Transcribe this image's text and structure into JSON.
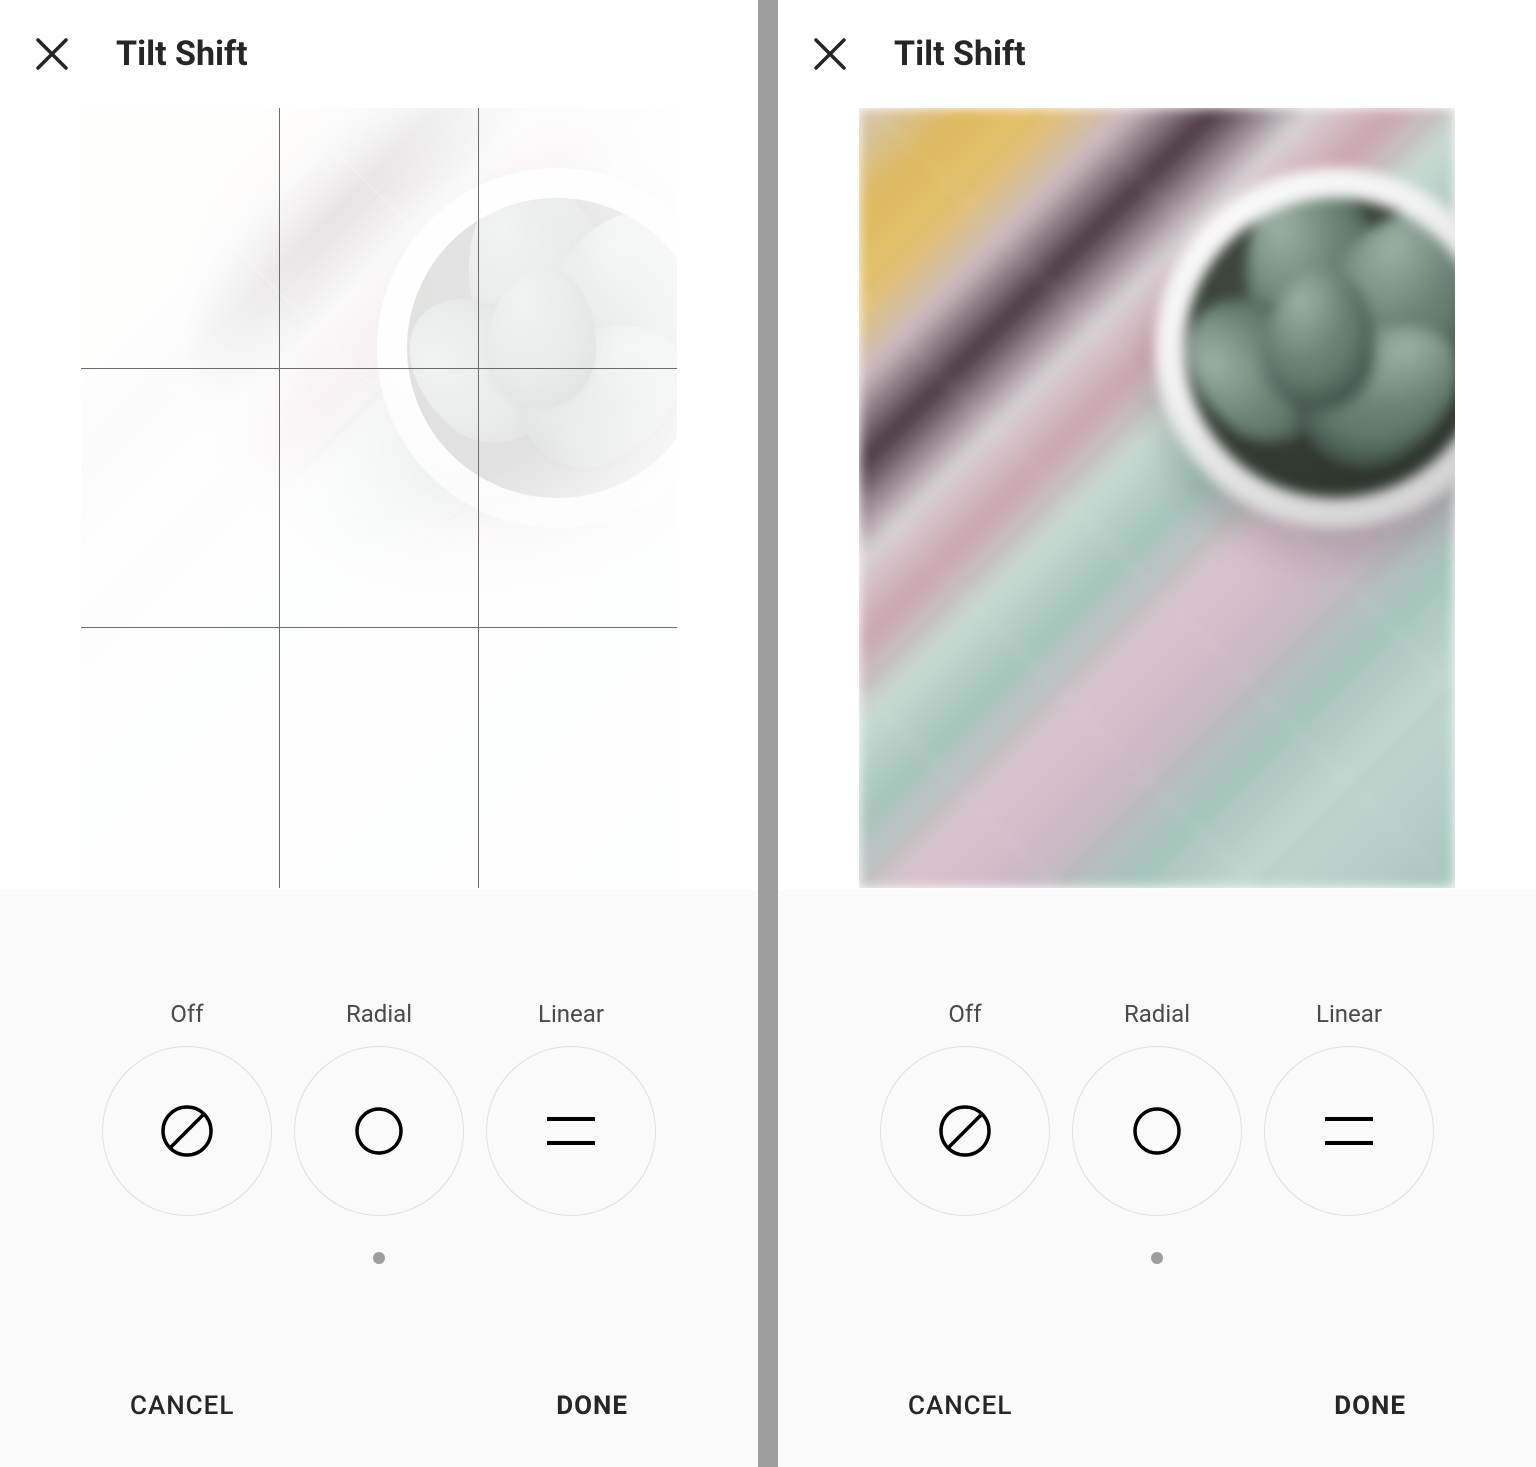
{
  "left": {
    "title": "Tilt Shift",
    "show_grid": true,
    "overlay": "washed",
    "options": {
      "off": "Off",
      "radial": "Radial",
      "linear": "Linear"
    },
    "footer": {
      "cancel": "CANCEL",
      "done": "DONE"
    }
  },
  "right": {
    "title": "Tilt Shift",
    "show_grid": false,
    "overlay": "none",
    "options": {
      "off": "Off",
      "radial": "Radial",
      "linear": "Linear"
    },
    "footer": {
      "cancel": "CANCEL",
      "done": "DONE"
    }
  },
  "icons": {
    "close": "close-icon",
    "off": "tilt-off-icon",
    "radial": "tilt-radial-icon",
    "linear": "tilt-linear-icon"
  }
}
